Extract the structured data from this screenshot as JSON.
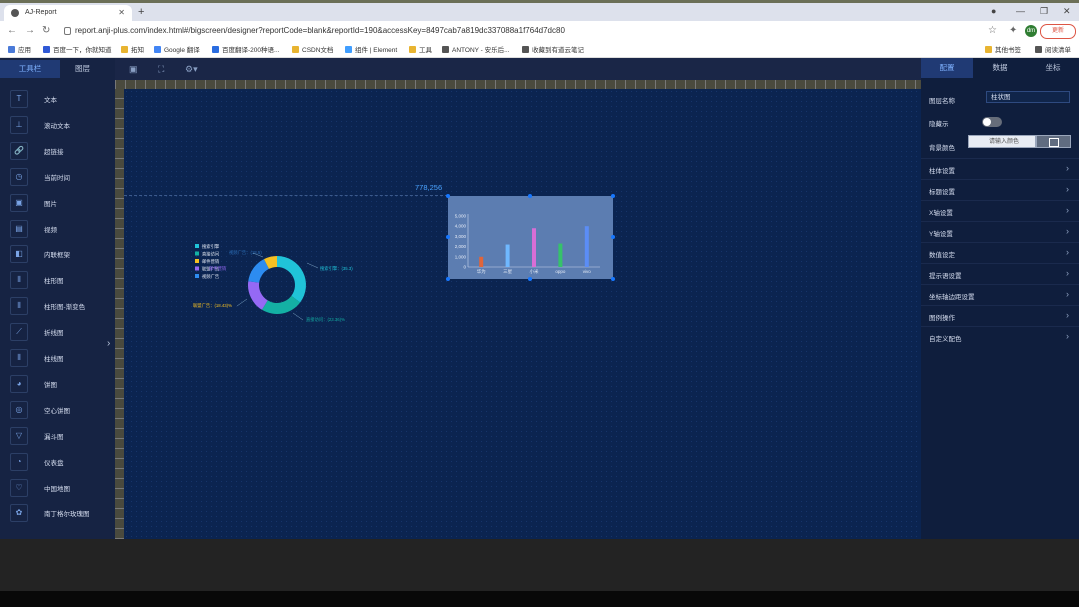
{
  "browser": {
    "tab_title": "AJ-Report",
    "url": "report.anji-plus.com/index.html#/bigscreen/designer?reportCode=blank&reportId=190&accessKey=8497cab7a819dc337088a1f764d7dc80",
    "avatar": "dm",
    "update_label": "更新",
    "bookmarks": [
      "应用",
      "百度一下，你就知道",
      "拓知",
      "Google 翻译",
      "百度翻译-200种语...",
      "CSDN文档",
      "组件 | Element",
      "工具",
      "ANTONY - 安乐后...",
      "收藏到有道云笔记"
    ],
    "bookmarks_right": [
      "其他书签",
      "阅读清单"
    ]
  },
  "left_panel": {
    "tabs": [
      "工具栏",
      "图层"
    ],
    "components": [
      {
        "icon": "text-icon",
        "glyph": "T",
        "label": "文本"
      },
      {
        "icon": "scroll-text-icon",
        "glyph": "⊥",
        "label": "滚动文本"
      },
      {
        "icon": "link-icon",
        "glyph": "🔗",
        "label": "超链接"
      },
      {
        "icon": "clock-icon",
        "glyph": "◷",
        "label": "当前时间"
      },
      {
        "icon": "image-icon",
        "glyph": "▣",
        "label": "图片"
      },
      {
        "icon": "video-icon",
        "glyph": "▤",
        "label": "视频"
      },
      {
        "icon": "iframe-icon",
        "glyph": "◧",
        "label": "内联框架"
      },
      {
        "icon": "bar-chart-icon",
        "glyph": "⫴",
        "label": "柱形图"
      },
      {
        "icon": "gradient-bar-icon",
        "glyph": "⫴",
        "label": "柱形图-渐变色"
      },
      {
        "icon": "line-chart-icon",
        "glyph": "⟋",
        "label": "折线图"
      },
      {
        "icon": "bar-line-icon",
        "glyph": "⫴",
        "label": "柱线图"
      },
      {
        "icon": "pie-chart-icon",
        "glyph": "◕",
        "label": "饼图"
      },
      {
        "icon": "ring-pie-icon",
        "glyph": "◎",
        "label": "空心饼图"
      },
      {
        "icon": "funnel-icon",
        "glyph": "▽",
        "label": "漏斗图"
      },
      {
        "icon": "gauge-icon",
        "glyph": "◔",
        "label": "仪表盘"
      },
      {
        "icon": "china-map-icon",
        "glyph": "♡",
        "label": "中国地图"
      },
      {
        "icon": "nightingale-icon",
        "glyph": "✿",
        "label": "南丁格尔玫瑰图"
      }
    ]
  },
  "canvas": {
    "coord_readout": "778,256"
  },
  "donut": {
    "legend": [
      {
        "label": "搜索引擎",
        "color": "#20c3d8"
      },
      {
        "label": "直接访问",
        "color": "#14b0a4"
      },
      {
        "label": "邮件营销",
        "color": "#f6c022"
      },
      {
        "label": "联盟广告",
        "color": "#9569f5"
      },
      {
        "label": "视频广告",
        "color": "#2d8cf0"
      }
    ],
    "labels": [
      "视频广告：(15.5)",
      "搜索引擎：(35.3)",
      "直接访问：(23.36)%",
      "联盟广告：(18.43)%",
      "邮件营销"
    ],
    "values": [
      35.3,
      23.36,
      18.43,
      15.5,
      7.41
    ]
  },
  "chart_data": {
    "type": "bar",
    "categories": [
      "华为",
      "三星",
      "小米",
      "oppo",
      "vivo"
    ],
    "values": [
      1000,
      2200,
      3800,
      2300,
      4000
    ],
    "colors": [
      "#e0653a",
      "#6fb8ff",
      "#d86ed6",
      "#36c26a",
      "#5b8df6"
    ],
    "ylim": [
      0,
      5000
    ],
    "yticks": [
      "5,000",
      "4,000",
      "3,000",
      "2,000",
      "1,000",
      "0"
    ]
  },
  "right_panel": {
    "tabs": [
      "配置",
      "数据",
      "坐标"
    ],
    "layer_name_label": "图层名称",
    "layer_name_value": "柱状图",
    "hide_label": "隐藏示",
    "bg_color_label": "背景颜色",
    "bg_color_placeholder": "请输入颜色",
    "sections": [
      "柱体设置",
      "标题设置",
      "X轴设置",
      "Y轴设置",
      "数值设定",
      "提示语设置",
      "坐标轴边距设置",
      "图例操作",
      "自定义配色"
    ]
  }
}
